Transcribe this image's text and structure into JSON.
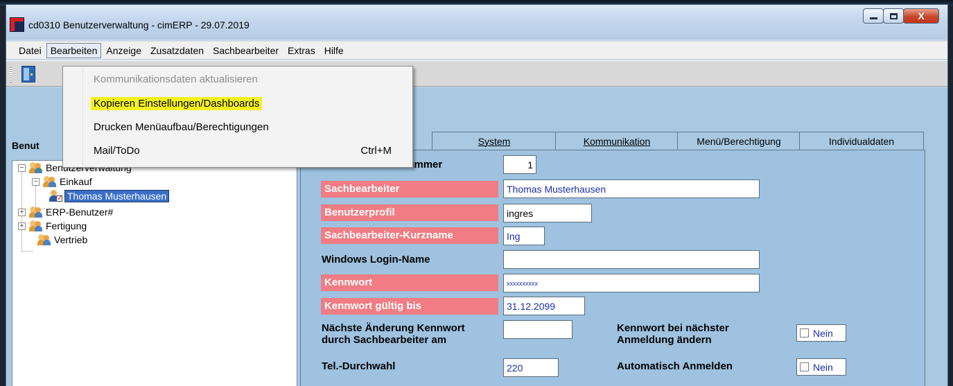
{
  "window": {
    "title": "cd0310 Benutzerverwaltung - cimERP - 29.07.2019",
    "close_glyph": "X"
  },
  "menubar": {
    "items": [
      "Datei",
      "Bearbeiten",
      "Anzeige",
      "Zusatzdaten",
      "Sachbearbeiter",
      "Extras",
      "Hilfe"
    ],
    "active": "Bearbeiten"
  },
  "dropdown": {
    "items": [
      {
        "label": "Kommunikationsdaten aktualisieren",
        "enabled": false,
        "shortcut": ""
      },
      {
        "label": "Kopieren Einstellungen/Dashboards",
        "enabled": true,
        "highlighted": true,
        "shortcut": ""
      },
      {
        "label": "Drucken Menüaufbau/Berechtigungen",
        "enabled": true,
        "shortcut": ""
      },
      {
        "label": "Mail/ToDo",
        "enabled": true,
        "shortcut": "Ctrl+M"
      }
    ],
    "highlight_color": "#f4f21e"
  },
  "left_panel": {
    "title_partial": "Benut",
    "tree": {
      "root": "Benutzerverwaltung",
      "groups": [
        {
          "label": "Einkauf",
          "expander": "−",
          "children": [
            "Thomas Musterhausen"
          ]
        },
        {
          "label": "ERP-Benutzer#",
          "expander": "+"
        },
        {
          "label": "Fertigung",
          "expander": "+"
        },
        {
          "label": "Vertrieb"
        }
      ],
      "root_expander": "−",
      "selected": "Thomas Musterhausen"
    }
  },
  "tabs": [
    {
      "label": "System",
      "underline_char": "S"
    },
    {
      "label": "Kommunikation",
      "underline_char": "K"
    },
    {
      "label": "Menü/Berechtigung",
      "underline_char": "r"
    },
    {
      "label": "Individualdaten"
    }
  ],
  "form": {
    "nummer": {
      "label": "Sachbearbeiter-Nummer",
      "value": "1"
    },
    "sachbearbeiter": {
      "label": "Sachbearbeiter",
      "value": "Thomas Musterhausen"
    },
    "profil": {
      "label": "Benutzerprofil",
      "value": "ingres"
    },
    "kurzname": {
      "label": "Sachbearbeiter-Kurzname",
      "value": "Ing"
    },
    "windows_login": {
      "label": "Windows Login-Name",
      "value": ""
    },
    "kennwort": {
      "label": "Kennwort",
      "value": "xxxxxxxxxx"
    },
    "kennwort_gueltig": {
      "label": "Kennwort gültig bis",
      "value": "31.12.2099"
    },
    "naechste_aenderung": {
      "label_line1": "Nächste Änderung Kennwort",
      "label_line2": "durch Sachbearbeiter am",
      "value": ""
    },
    "kennwort_aendern": {
      "label_line1": "Kennwort bei nächster",
      "label_line2": "Anmeldung ändern",
      "value": "Nein",
      "checked": false
    },
    "durchwahl": {
      "label": "Tel.-Durchwahl",
      "value": "220"
    },
    "auto_anmelden": {
      "label": "Automatisch Anmelden",
      "value": "Nein",
      "checked": false
    }
  },
  "colors": {
    "required_label_bg": "#f17c83",
    "panel_bg": "#9ec2df",
    "value_text": "#1b2fa8"
  }
}
